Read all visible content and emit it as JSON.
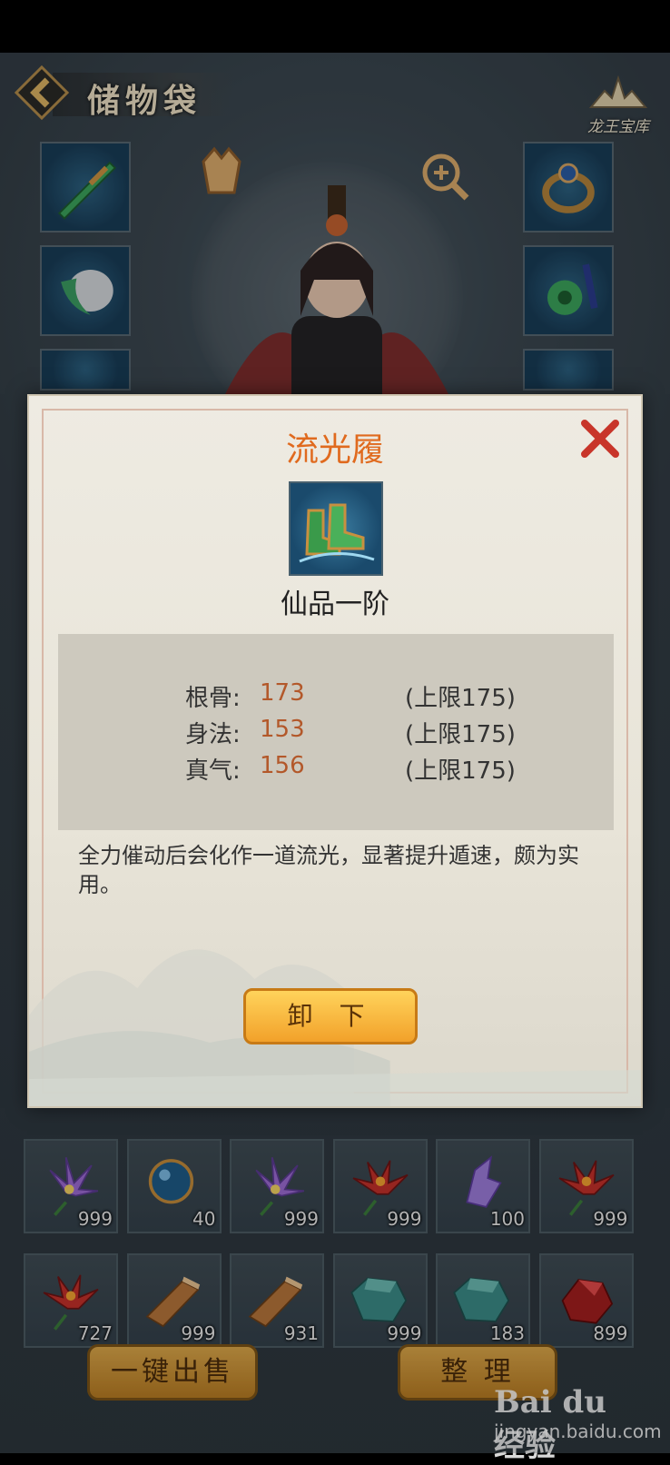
{
  "header": {
    "title": "储物袋",
    "vault_label": "龙王宝库"
  },
  "modal": {
    "item_name": "流光履",
    "grade": "仙品一阶",
    "stats": [
      {
        "label": "根骨:",
        "value": "173",
        "limit": "(上限175)"
      },
      {
        "label": "身法:",
        "value": "153",
        "limit": "(上限175)"
      },
      {
        "label": "真气:",
        "value": "156",
        "limit": "(上限175)"
      }
    ],
    "description": "全力催动后会化作一道流光，显著提升遁速，颇为实用。",
    "unequip_label": "卸 下"
  },
  "inventory": {
    "row1": [
      {
        "icon": "purple-lotus-icon",
        "qty": "999"
      },
      {
        "icon": "blue-orb-icon",
        "qty": "40"
      },
      {
        "icon": "purple-lotus-icon",
        "qty": "999"
      },
      {
        "icon": "red-lotus-icon",
        "qty": "999"
      },
      {
        "icon": "purple-crystal-icon",
        "qty": "100"
      },
      {
        "icon": "red-lotus-icon",
        "qty": "999"
      }
    ],
    "row2": [
      {
        "icon": "red-lotus-icon",
        "qty": "727"
      },
      {
        "icon": "wood-plank-icon",
        "qty": "999"
      },
      {
        "icon": "wood-plank-icon",
        "qty": "931"
      },
      {
        "icon": "jade-stone-icon",
        "qty": "999"
      },
      {
        "icon": "jade-stone-icon",
        "qty": "183"
      },
      {
        "icon": "red-ore-icon",
        "qty": "899"
      }
    ]
  },
  "buttons": {
    "sell_all": "一键出售",
    "sort": "整 理"
  },
  "watermark": {
    "logo": "Bai du 经验",
    "url": "jingyan.baidu.com"
  },
  "colors": {
    "title_orange": "#e06a1e",
    "stat_value": "#b3582a",
    "button_gold": "#f2a12a"
  }
}
